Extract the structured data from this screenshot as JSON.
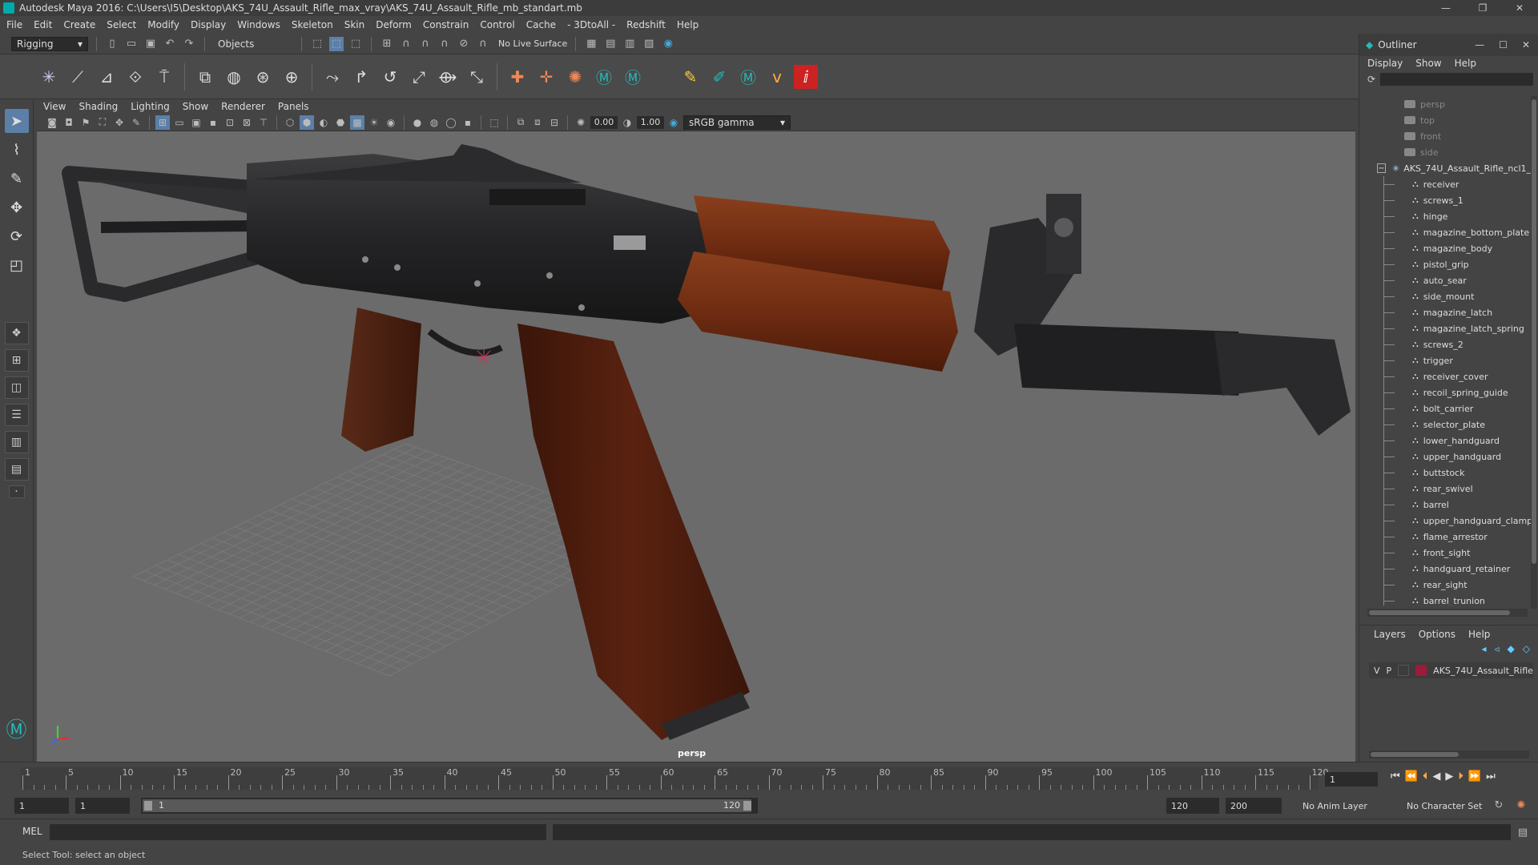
{
  "window": {
    "title": "Autodesk Maya 2016: C:\\Users\\I5\\Desktop\\AKS_74U_Assault_Rifle_max_vray\\AKS_74U_Assault_Rifle_mb_standart.mb",
    "min_glyph": "—",
    "max_glyph": "❐",
    "close_glyph": "✕"
  },
  "menubar": [
    "File",
    "Edit",
    "Create",
    "Select",
    "Modify",
    "Display",
    "Windows",
    "Skeleton",
    "Skin",
    "Deform",
    "Constrain",
    "Control",
    "Cache",
    "- 3DtoAll -",
    "Redshift",
    "Help"
  ],
  "statusline": {
    "menuset": "Rigging",
    "select_mode": "Objects",
    "live_surface": "No Live Surface"
  },
  "viewport": {
    "menus": [
      "View",
      "Shading",
      "Lighting",
      "Show",
      "Renderer",
      "Panels"
    ],
    "exposure": "0.00",
    "gamma": "1.00",
    "color_space": "sRGB gamma",
    "camera": "persp"
  },
  "outliner": {
    "title": "Outliner",
    "menus": [
      "Display",
      "Show",
      "Help"
    ],
    "cameras": [
      "persp",
      "top",
      "front",
      "side"
    ],
    "root": "AKS_74U_Assault_Rifle_ncl1_",
    "children": [
      "receiver",
      "screws_1",
      "hinge",
      "magazine_bottom_plate",
      "magazine_body",
      "pistol_grip",
      "auto_sear",
      "side_mount",
      "magazine_latch",
      "magazine_latch_spring",
      "screws_2",
      "trigger",
      "receiver_cover",
      "recoil_spring_guide",
      "bolt_carrier",
      "selector_plate",
      "lower_handguard",
      "upper_handguard",
      "buttstock",
      "rear_swivel",
      "barrel",
      "upper_handguard_clamp",
      "flame_arrestor",
      "front_sight",
      "handguard_retainer",
      "rear_sight",
      "barrel_trunion"
    ]
  },
  "layers": {
    "menus": [
      "Layers",
      "Options",
      "Help"
    ],
    "row": {
      "v": "V",
      "p": "P",
      "name": "AKS_74U_Assault_Rifle",
      "color": "#9b1b3a"
    }
  },
  "timeline": {
    "labels": [
      "1",
      "5",
      "10",
      "15",
      "20",
      "25",
      "30",
      "35",
      "40",
      "45",
      "50",
      "55",
      "60",
      "65",
      "70",
      "75",
      "80",
      "85",
      "90",
      "95",
      "100",
      "105",
      "110",
      "115",
      "120"
    ],
    "current_frame": "1"
  },
  "range": {
    "start": "1",
    "playback_start": "1",
    "handle_start": "1",
    "handle_end": "120",
    "playback_end": "120",
    "end": "200",
    "anim_layer": "No Anim Layer",
    "character_set": "No Character Set"
  },
  "cmdline": {
    "language": "MEL"
  },
  "helpline": {
    "text": "Select Tool: select an object"
  },
  "colors": {
    "accent": "#5c7fa8",
    "viewport_bg": "#6b6b6b",
    "wood": "#7a3416",
    "metal": "#2a2a2c"
  }
}
